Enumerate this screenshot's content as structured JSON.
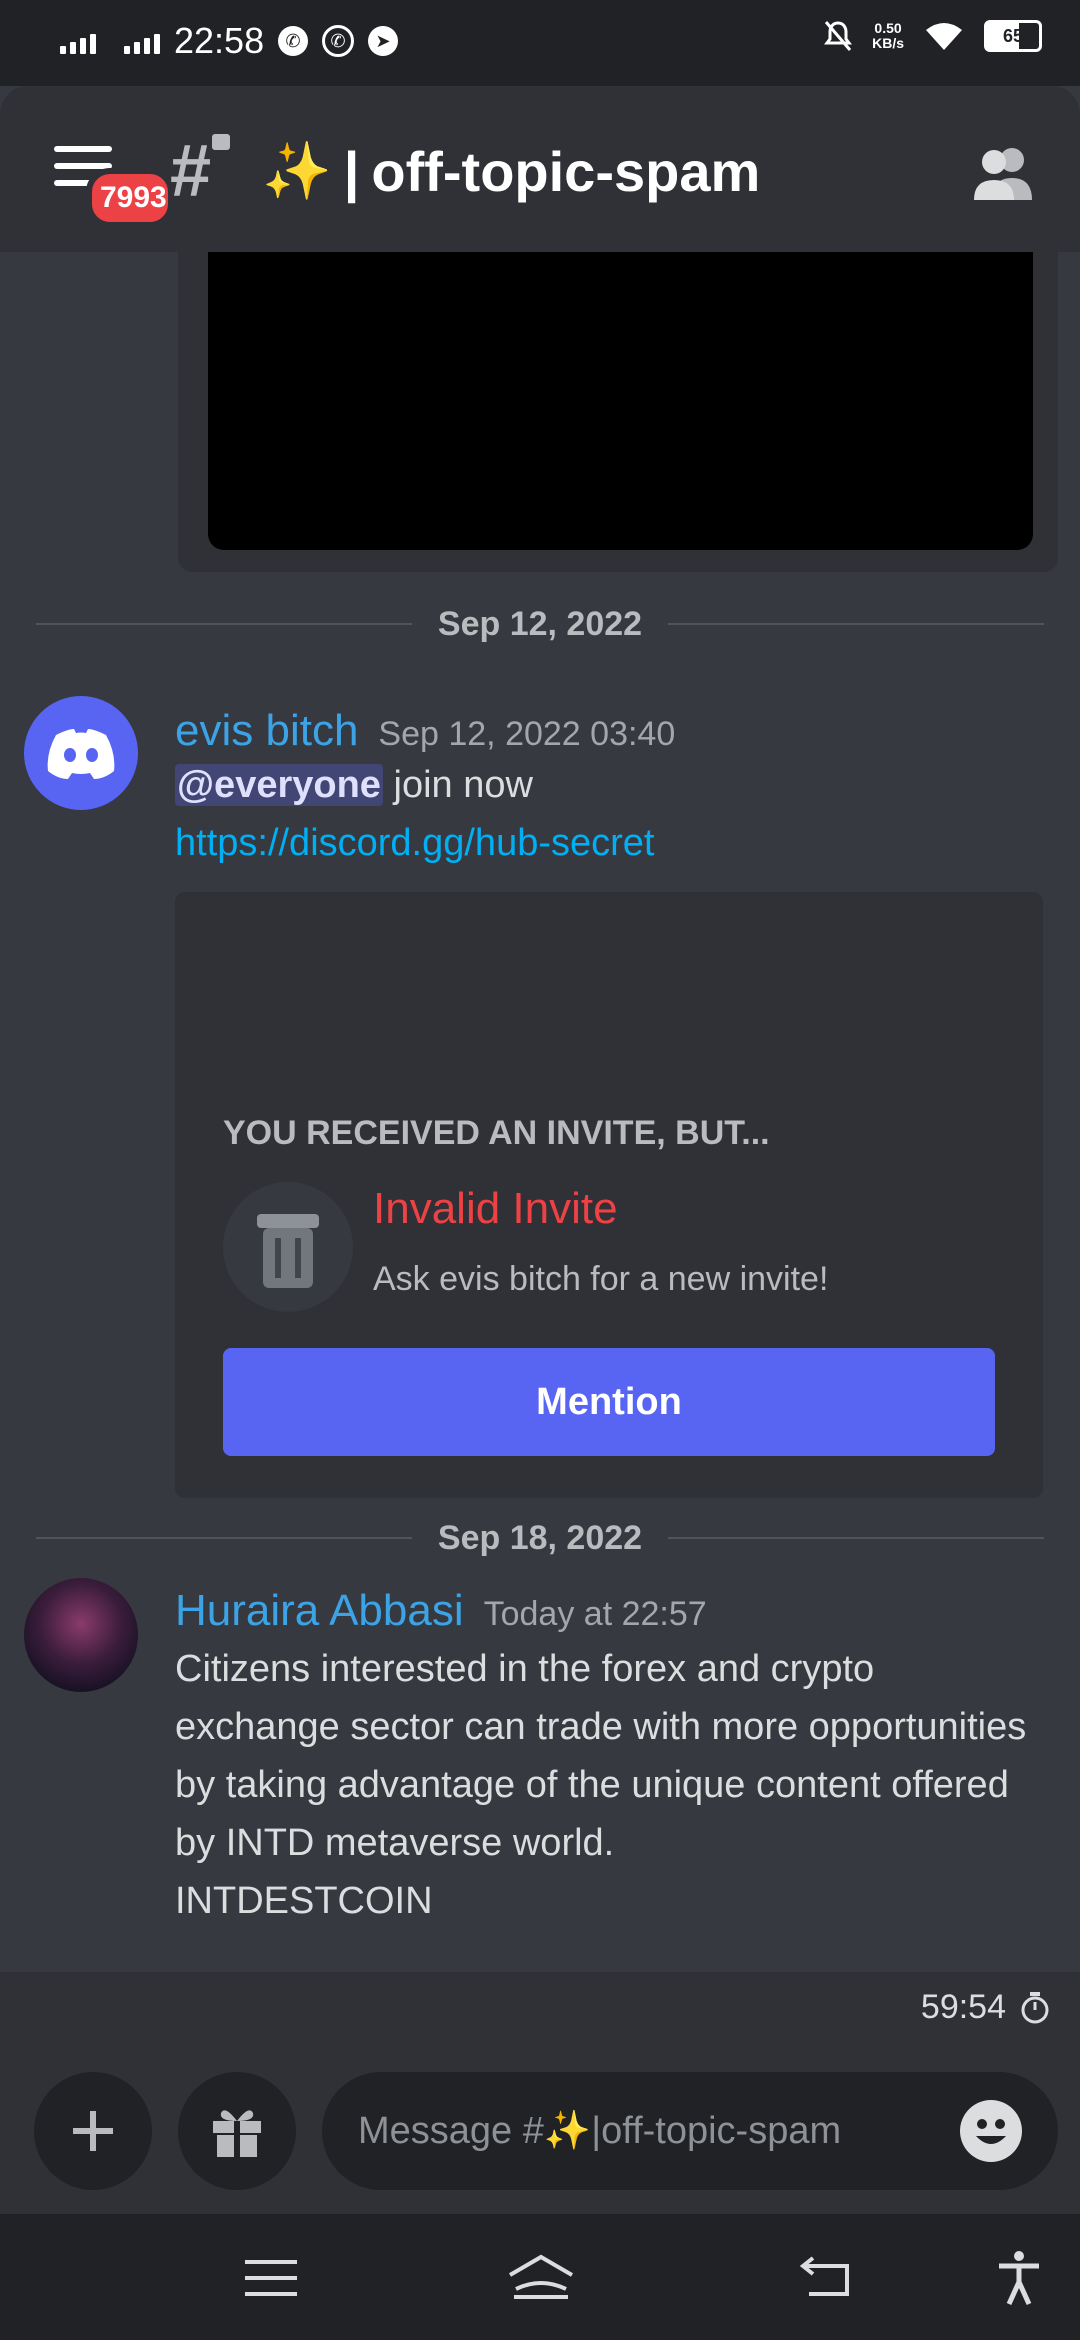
{
  "status_bar": {
    "time": "22:58",
    "net_speed_value": "0.50",
    "net_speed_unit": "KB/s",
    "battery": "65"
  },
  "header": {
    "unread_badge": "7993",
    "channel_emoji": "✨",
    "channel_sep": "|",
    "channel_name": "off-topic-spam"
  },
  "messages": [
    {
      "date_separator": "Sep 12, 2022",
      "author": "evis bitch",
      "timestamp": "Sep 12, 2022 03:40",
      "mention": "@everyone",
      "text": " join now",
      "link": "https://discord.gg/hub-secret",
      "invite": {
        "heading": "YOU RECEIVED AN INVITE, BUT...",
        "title": "Invalid Invite",
        "subtitle": "Ask evis bitch for a new invite!",
        "button": "Mention"
      }
    },
    {
      "date_separator": "Sep 18, 2022",
      "author": "Huraira Abbasi",
      "timestamp": "Today at 22:57",
      "text_lines": [
        "Citizens interested in the forex and crypto",
        "exchange sector can trade with more opportunities",
        "by taking advantage of the unique content offered",
        "by INTD metaverse world.",
        "INTDESTCOIN"
      ]
    }
  ],
  "timer": "59:54",
  "composer": {
    "placeholder": "Message #✨|off-topic-spam"
  },
  "colors": {
    "accent": "#5865f2",
    "author": "#3ba3e6",
    "error": "#ed4245",
    "link": "#00aff4"
  }
}
